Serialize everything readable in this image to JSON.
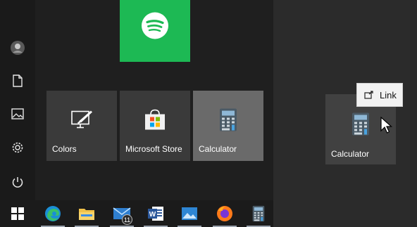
{
  "rail": {
    "icons": [
      "avatar",
      "document-icon",
      "pictures-icon",
      "settings-icon",
      "power-icon"
    ]
  },
  "tiles": [
    {
      "name": "Spotify",
      "label": "",
      "icon": "spotify-icon",
      "color": "#1db954"
    },
    {
      "name": "Colors",
      "label": "Colors",
      "icon": "colors-icon"
    },
    {
      "name": "Microsoft Store",
      "label": "Microsoft Store",
      "icon": "store-icon"
    },
    {
      "name": "Calculator",
      "label": "Calculator",
      "icon": "calculator-icon"
    }
  ],
  "drag": {
    "tile_label": "Calculator",
    "tooltip": "Link"
  },
  "taskbar": {
    "items": [
      "windows-start-icon",
      "edge-icon",
      "file-explorer-icon",
      "mail-icon",
      "word-icon",
      "photos-icon",
      "firefox-icon",
      "calculator-icon"
    ],
    "mail_badge": "11"
  },
  "colors": {
    "spotify": "#1db954",
    "accent_dark": "#1f1f1f"
  }
}
